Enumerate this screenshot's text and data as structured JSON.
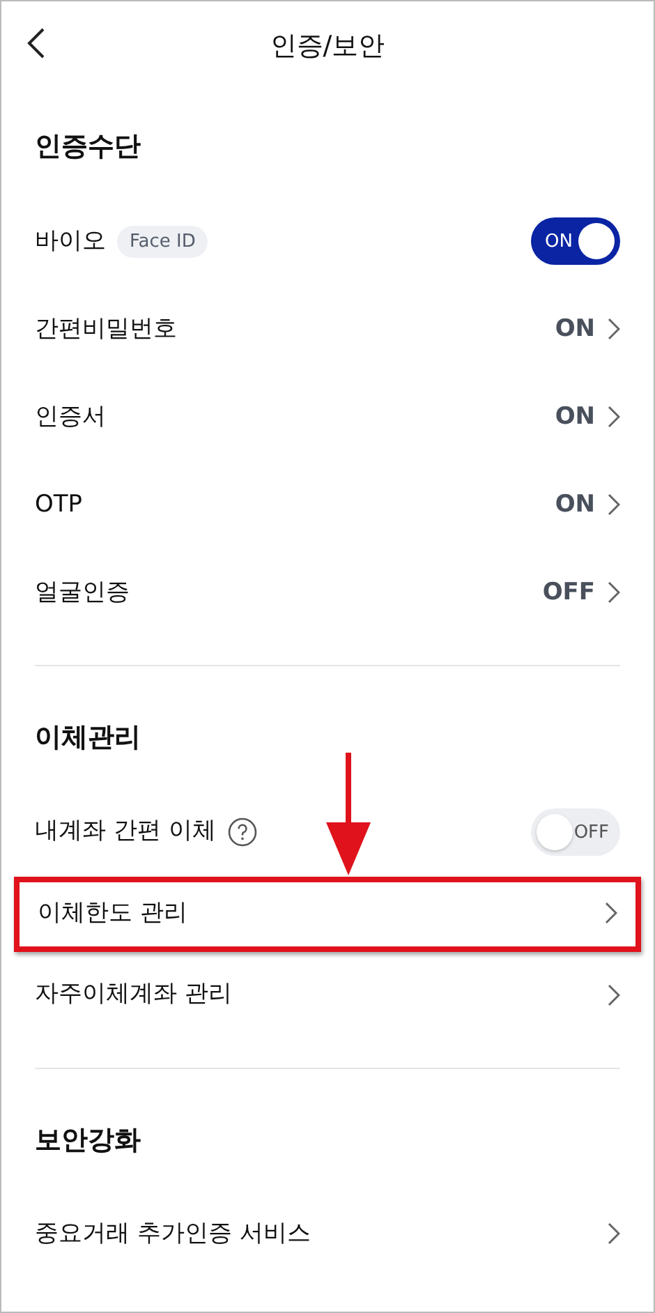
{
  "header": {
    "title": "인증/보안"
  },
  "sections": [
    {
      "title": "인증수단",
      "items": [
        {
          "kind": "toggle",
          "label": "바이오",
          "badge": "Face ID",
          "on": true,
          "state": "ON"
        },
        {
          "kind": "value",
          "label": "간편비밀번호",
          "state": "ON"
        },
        {
          "kind": "value",
          "label": "인증서",
          "state": "ON"
        },
        {
          "kind": "value",
          "label": "OTP",
          "state": "ON"
        },
        {
          "kind": "value",
          "label": "얼굴인증",
          "state": "OFF"
        }
      ]
    },
    {
      "title": "이체관리",
      "items": [
        {
          "kind": "toggle",
          "label": "내계좌 간편 이체",
          "help": true,
          "on": false,
          "state": "OFF"
        },
        {
          "kind": "link",
          "label": "이체한도 관리",
          "highlighted": true
        },
        {
          "kind": "link",
          "label": "자주이체계좌 관리",
          "highlighted": false
        }
      ]
    },
    {
      "title": "보안강화",
      "items": [
        {
          "kind": "link",
          "label": "중요거래 추가인증 서비스",
          "highlighted": false
        }
      ]
    }
  ]
}
